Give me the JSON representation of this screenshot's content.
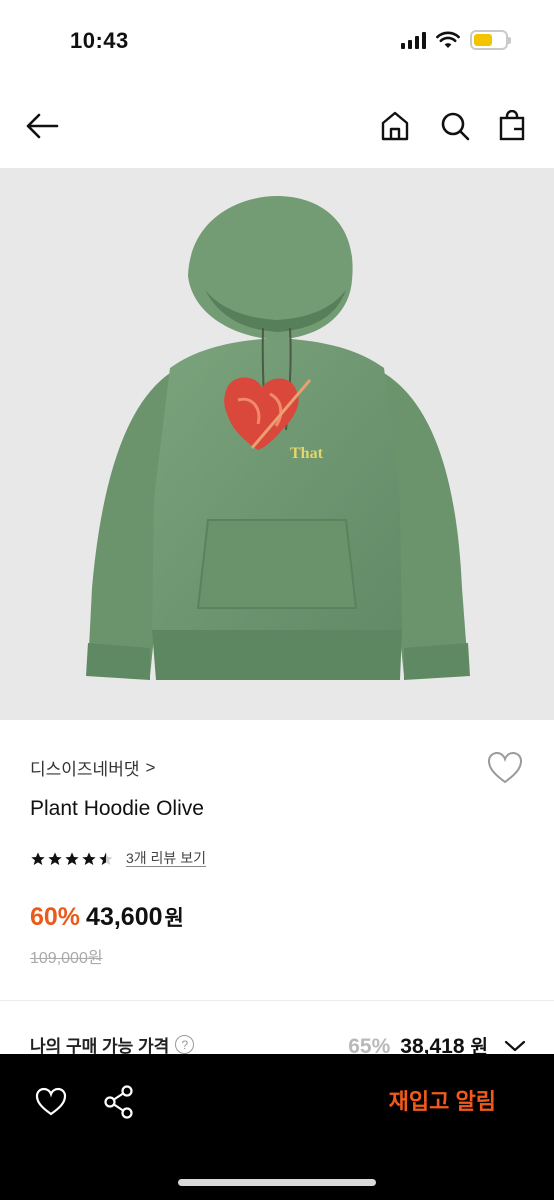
{
  "status_bar": {
    "time": "10:43"
  },
  "nav": {
    "back_icon": "arrow-left-icon",
    "home_icon": "home-icon",
    "search_icon": "search-icon",
    "cart_icon": "shopping-bag-icon"
  },
  "product": {
    "image_alt_text": "That",
    "brand": "디스이즈네버댓",
    "brand_chevron": ">",
    "name": "Plant Hoodie Olive",
    "rating": 4.5,
    "review_link": "3개 리뷰 보기",
    "discount": "60%",
    "price": "43,600",
    "price_unit": "원",
    "original_price": "109,000원"
  },
  "purchase": {
    "label": "나의 구매 가능 가격",
    "help": "?",
    "discount": "65%",
    "price": "38,418",
    "unit": "원"
  },
  "bottom_bar": {
    "restock_button": "재입고 알림"
  },
  "colors": {
    "accent": "#ea5a1a",
    "hoodie": "#6f9670",
    "print": "#d9483a"
  }
}
